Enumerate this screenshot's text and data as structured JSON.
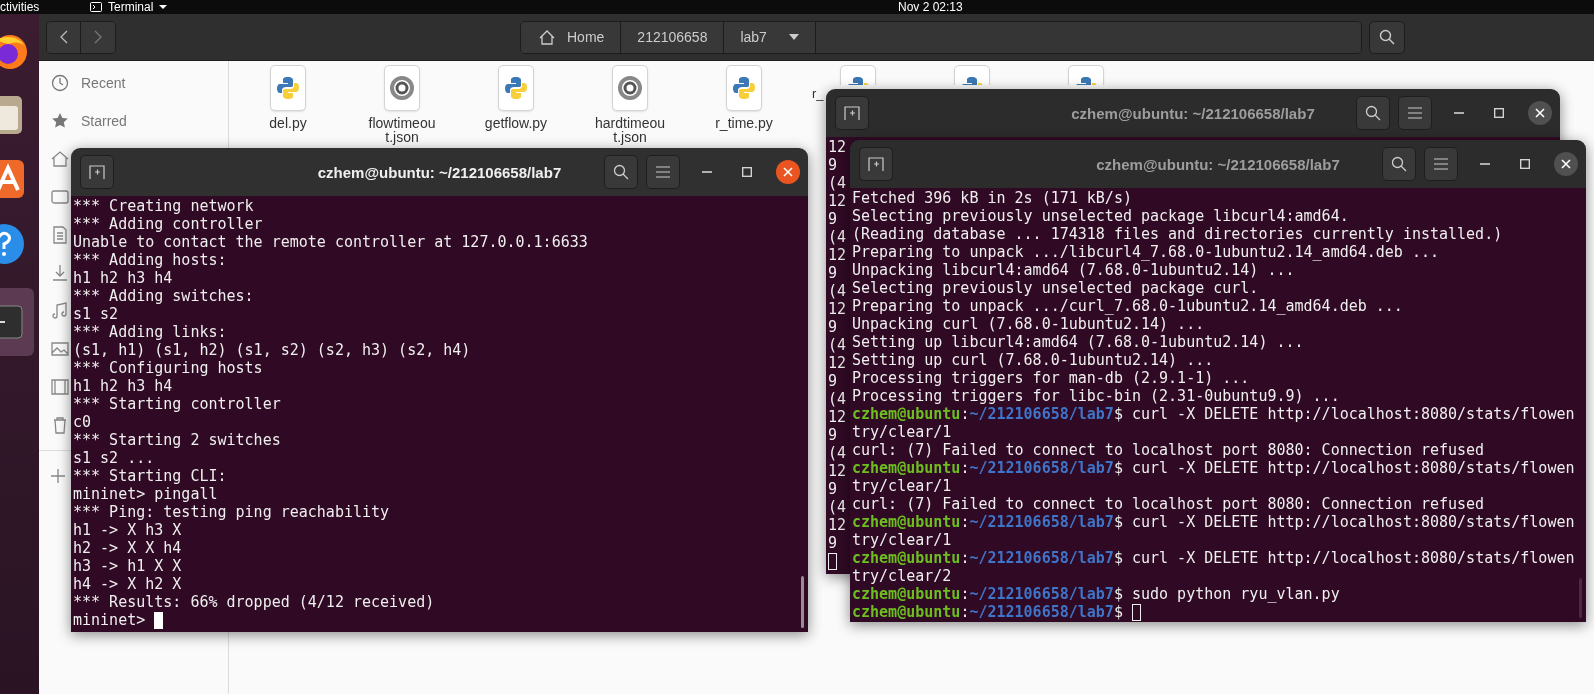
{
  "top_bar": {
    "activities": "ctivities",
    "app_menu": "Terminal",
    "clock": "Nov 2  02:13"
  },
  "dock": {
    "items": [
      {
        "kind": "browser",
        "selected": false
      },
      {
        "kind": "files",
        "selected": false
      },
      {
        "kind": "store",
        "selected": false
      },
      {
        "kind": "help",
        "selected": false
      },
      {
        "kind": "terminal",
        "selected": true
      }
    ]
  },
  "file_manager": {
    "path": [
      {
        "label": "Home",
        "kind": "home"
      },
      {
        "label": "212106658",
        "kind": "folder"
      },
      {
        "label": "lab7",
        "kind": "current"
      }
    ],
    "sidebar": {
      "items": [
        {
          "label": "Recent",
          "kind": "recent"
        },
        {
          "label": "Starred",
          "kind": "starred"
        }
      ]
    },
    "files": [
      {
        "kind": "python",
        "label_lines": [
          "del.py"
        ]
      },
      {
        "kind": "json",
        "label_lines": [
          "flowtimeou",
          "t.json"
        ]
      },
      {
        "kind": "python",
        "label_lines": [
          "getflow.py"
        ]
      },
      {
        "kind": "json",
        "label_lines": [
          "hardtimeou",
          "t.json"
        ]
      },
      {
        "kind": "python",
        "label_lines": [
          "r_time.py"
        ]
      },
      {
        "kind": "python",
        "label_lines": [
          "r_"
        ]
      },
      {
        "kind": "python"
      },
      {
        "kind": "python"
      }
    ]
  },
  "terminals": [
    {
      "title": "czhem@ubuntu: ~/212106658/lab7",
      "focused": true,
      "lines": [
        {
          "kind": "output",
          "text": "*** Creating network"
        },
        {
          "kind": "output",
          "text": "*** Adding controller"
        },
        {
          "kind": "output",
          "text": "Unable to contact the remote controller at 127.0.0.1:6633"
        },
        {
          "kind": "output",
          "text": "*** Adding hosts:"
        },
        {
          "kind": "output",
          "text": "h1 h2 h3 h4"
        },
        {
          "kind": "output",
          "text": "*** Adding switches:"
        },
        {
          "kind": "output",
          "text": "s1 s2"
        },
        {
          "kind": "output",
          "text": "*** Adding links:"
        },
        {
          "kind": "output",
          "text": "(s1, h1) (s1, h2) (s1, s2) (s2, h3) (s2, h4)"
        },
        {
          "kind": "output",
          "text": "*** Configuring hosts"
        },
        {
          "kind": "output",
          "text": "h1 h2 h3 h4"
        },
        {
          "kind": "output",
          "text": "*** Starting controller"
        },
        {
          "kind": "output",
          "text": "c0"
        },
        {
          "kind": "output",
          "text": "*** Starting 2 switches"
        },
        {
          "kind": "output",
          "text": "s1 s2 ..."
        },
        {
          "kind": "output",
          "text": "*** Starting CLI:"
        },
        {
          "kind": "output",
          "text": "mininet> pingall"
        },
        {
          "kind": "output",
          "text": "*** Ping: testing ping reachability"
        },
        {
          "kind": "output",
          "text": "h1 -> X h3 X"
        },
        {
          "kind": "output",
          "text": "h2 -> X X h4"
        },
        {
          "kind": "output",
          "text": "h3 -> h1 X X"
        },
        {
          "kind": "output",
          "text": "h4 -> X h2 X"
        },
        {
          "kind": "output",
          "text": "*** Results: 66% dropped (4/12 received)"
        },
        {
          "kind": "output",
          "text": "mininet> ",
          "cursor": true
        }
      ]
    },
    {
      "title": "czhem@ubuntu: ~/212106658/lab7",
      "focused": false,
      "lines": [
        {
          "kind": "output",
          "text": "12"
        },
        {
          "kind": "output",
          "text": "9"
        },
        {
          "kind": "output",
          "text": "(4"
        },
        {
          "kind": "output",
          "text": "12"
        },
        {
          "kind": "output",
          "text": "9"
        },
        {
          "kind": "output",
          "text": "(4"
        },
        {
          "kind": "output",
          "text": "12"
        },
        {
          "kind": "output",
          "text": "9"
        },
        {
          "kind": "output",
          "text": "(4"
        },
        {
          "kind": "output",
          "text": "12"
        },
        {
          "kind": "output",
          "text": "9"
        },
        {
          "kind": "output",
          "text": "(4"
        },
        {
          "kind": "output",
          "text": "12"
        },
        {
          "kind": "output",
          "text": "9"
        },
        {
          "kind": "output",
          "text": "(4"
        },
        {
          "kind": "output",
          "text": "12"
        },
        {
          "kind": "output",
          "text": "9"
        },
        {
          "kind": "output",
          "text": "(4"
        },
        {
          "kind": "output",
          "text": "12"
        },
        {
          "kind": "output",
          "text": "9"
        },
        {
          "kind": "output",
          "text": "(4"
        },
        {
          "kind": "output",
          "text": "12"
        },
        {
          "kind": "output",
          "text": "9"
        },
        {
          "kind": "blank",
          "cursor": true
        }
      ]
    },
    {
      "title": "czhem@ubuntu: ~/212106658/lab7",
      "focused": false,
      "lines": [
        {
          "kind": "output",
          "text": "Fetched 396 kB in 2s (171 kB/s)"
        },
        {
          "kind": "output",
          "text": "Selecting previously unselected package libcurl4:amd64."
        },
        {
          "kind": "output",
          "text": "(Reading database ... 174318 files and directories currently installed.)"
        },
        {
          "kind": "output",
          "text": "Preparing to unpack .../libcurl4_7.68.0-1ubuntu2.14_amd64.deb ..."
        },
        {
          "kind": "output",
          "text": "Unpacking libcurl4:amd64 (7.68.0-1ubuntu2.14) ..."
        },
        {
          "kind": "output",
          "text": "Selecting previously unselected package curl."
        },
        {
          "kind": "output",
          "text": "Preparing to unpack .../curl_7.68.0-1ubuntu2.14_amd64.deb ..."
        },
        {
          "kind": "output",
          "text": "Unpacking curl (7.68.0-1ubuntu2.14) ..."
        },
        {
          "kind": "output",
          "text": "Setting up libcurl4:amd64 (7.68.0-1ubuntu2.14) ..."
        },
        {
          "kind": "output",
          "text": "Setting up curl (7.68.0-1ubuntu2.14) ..."
        },
        {
          "kind": "output",
          "text": "Processing triggers for man-db (2.9.1-1) ..."
        },
        {
          "kind": "output",
          "text": "Processing triggers for libc-bin (2.31-0ubuntu9.9) ..."
        },
        {
          "kind": "prompt",
          "user": "czhem@ubuntu",
          "sep": ":",
          "path": "~/212106658/lab7",
          "sign": "$ ",
          "command": "curl -X DELETE http://localhost:8080/stats/flowen"
        },
        {
          "kind": "output",
          "text": "try/clear/1"
        },
        {
          "kind": "output",
          "text": "curl: (7) Failed to connect to localhost port 8080: Connection refused"
        },
        {
          "kind": "prompt",
          "user": "czhem@ubuntu",
          "sep": ":",
          "path": "~/212106658/lab7",
          "sign": "$ ",
          "command": "curl -X DELETE http://localhost:8080/stats/flowen"
        },
        {
          "kind": "output",
          "text": "try/clear/1"
        },
        {
          "kind": "output",
          "text": "curl: (7) Failed to connect to localhost port 8080: Connection refused"
        },
        {
          "kind": "prompt",
          "user": "czhem@ubuntu",
          "sep": ":",
          "path": "~/212106658/lab7",
          "sign": "$ ",
          "command": "curl -X DELETE http://localhost:8080/stats/flowen"
        },
        {
          "kind": "output",
          "text": "try/clear/1"
        },
        {
          "kind": "prompt",
          "user": "czhem@ubuntu",
          "sep": ":",
          "path": "~/212106658/lab7",
          "sign": "$ ",
          "command": "curl -X DELETE http://localhost:8080/stats/flowen"
        },
        {
          "kind": "output",
          "text": "try/clear/2"
        },
        {
          "kind": "prompt",
          "user": "czhem@ubuntu",
          "sep": ":",
          "path": "~/212106658/lab7",
          "sign": "$ ",
          "command": "sudo python ryu_vlan.py"
        },
        {
          "kind": "prompt",
          "user": "czhem@ubuntu",
          "sep": ":",
          "path": "~/212106658/lab7",
          "sign": "$ ",
          "cursor": true
        }
      ]
    }
  ]
}
